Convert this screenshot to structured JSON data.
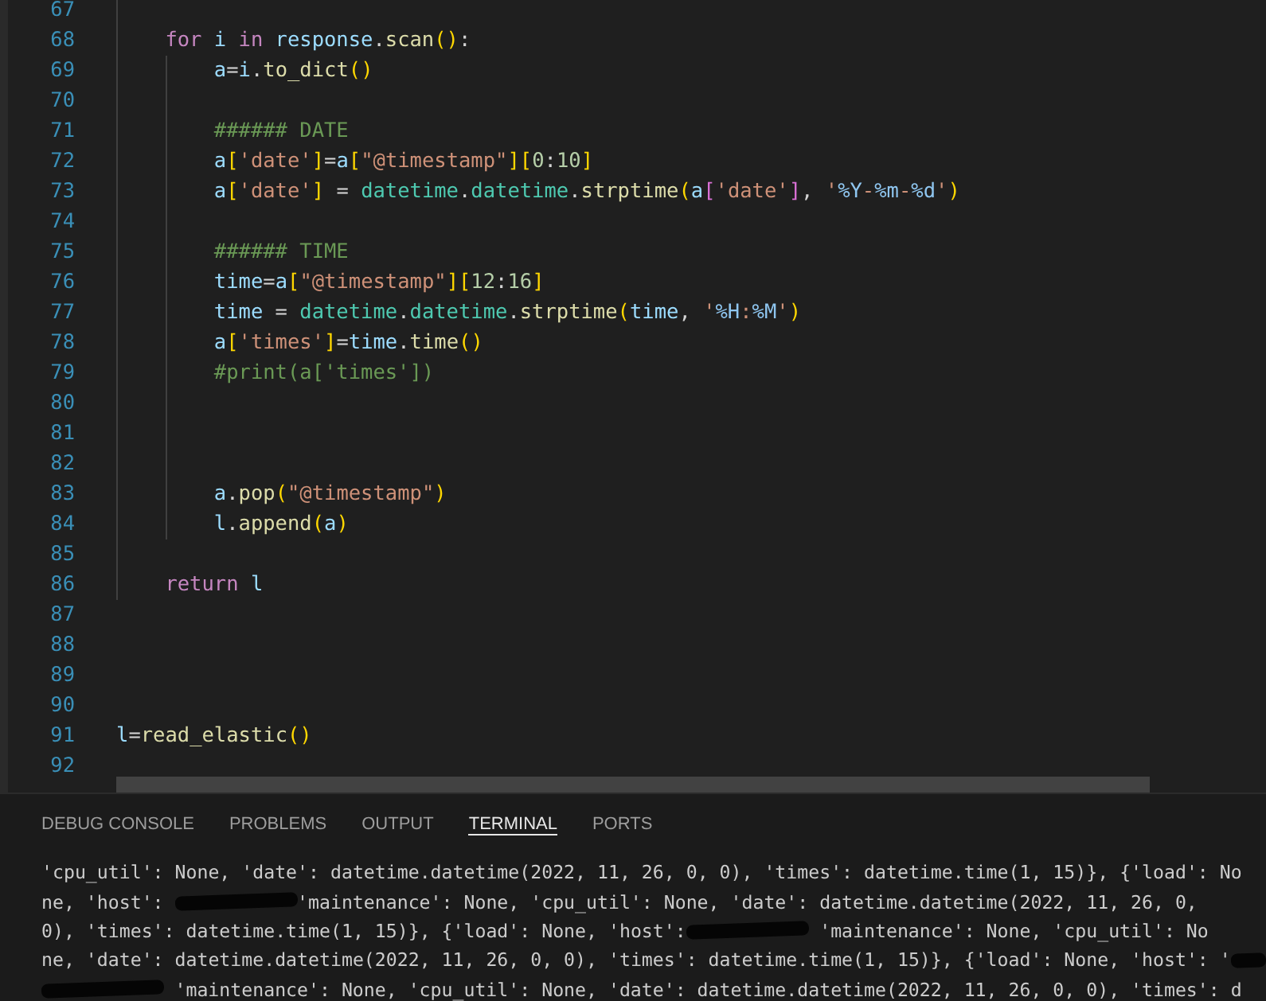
{
  "editor": {
    "lines": [
      {
        "number": "67"
      },
      {
        "number": "68",
        "tokens": [
          {
            "text": "    for",
            "kind": "keyword"
          },
          {
            "text": " i",
            "kind": "variable"
          },
          {
            "text": " in",
            "kind": "keyword"
          },
          {
            "text": " response",
            "kind": "variable"
          },
          {
            "text": ".",
            "kind": "plain"
          },
          {
            "text": "scan",
            "kind": "function"
          },
          {
            "text": "()",
            "kind": "bracket"
          },
          {
            "text": ":",
            "kind": "plain"
          }
        ]
      },
      {
        "number": "69",
        "tokens": [
          {
            "text": "        a",
            "kind": "variable"
          },
          {
            "text": "=",
            "kind": "plain"
          },
          {
            "text": "i",
            "kind": "variable"
          },
          {
            "text": ".",
            "kind": "plain"
          },
          {
            "text": "to_dict",
            "kind": "function"
          },
          {
            "text": "()",
            "kind": "bracket"
          }
        ]
      },
      {
        "number": "70"
      },
      {
        "number": "71",
        "tokens": [
          {
            "text": "        ###### DATE",
            "kind": "comment"
          }
        ]
      },
      {
        "number": "72",
        "tokens": [
          {
            "text": "        a",
            "kind": "variable"
          },
          {
            "text": "[",
            "kind": "bracket"
          },
          {
            "text": "'date'",
            "kind": "string"
          },
          {
            "text": "]",
            "kind": "bracket"
          },
          {
            "text": "=",
            "kind": "plain"
          },
          {
            "text": "a",
            "kind": "variable"
          },
          {
            "text": "[",
            "kind": "bracket"
          },
          {
            "text": "\"@timestamp\"",
            "kind": "string"
          },
          {
            "text": "][",
            "kind": "bracket"
          },
          {
            "text": "0",
            "kind": "number"
          },
          {
            "text": ":",
            "kind": "plain"
          },
          {
            "text": "10",
            "kind": "number"
          },
          {
            "text": "]",
            "kind": "bracket"
          }
        ]
      },
      {
        "number": "73",
        "tokens": [
          {
            "text": "        a",
            "kind": "variable"
          },
          {
            "text": "[",
            "kind": "bracket"
          },
          {
            "text": "'date'",
            "kind": "string"
          },
          {
            "text": "]",
            "kind": "bracket"
          },
          {
            "text": " = ",
            "kind": "plain"
          },
          {
            "text": "datetime",
            "kind": "module"
          },
          {
            "text": ".",
            "kind": "plain"
          },
          {
            "text": "datetime",
            "kind": "module"
          },
          {
            "text": ".",
            "kind": "plain"
          },
          {
            "text": "strptime",
            "kind": "function"
          },
          {
            "text": "(",
            "kind": "bracket"
          },
          {
            "text": "a",
            "kind": "variable"
          },
          {
            "text": "[",
            "kind": "bracket2"
          },
          {
            "text": "'date'",
            "kind": "string"
          },
          {
            "text": "]",
            "kind": "bracket2"
          },
          {
            "text": ", ",
            "kind": "plain"
          },
          {
            "text": "'",
            "kind": "string"
          },
          {
            "text": "%Y",
            "kind": "format"
          },
          {
            "text": "-",
            "kind": "string"
          },
          {
            "text": "%m",
            "kind": "format"
          },
          {
            "text": "-",
            "kind": "string"
          },
          {
            "text": "%d",
            "kind": "format"
          },
          {
            "text": "'",
            "kind": "string"
          },
          {
            "text": ")",
            "kind": "bracket"
          }
        ]
      },
      {
        "number": "74"
      },
      {
        "number": "75",
        "tokens": [
          {
            "text": "        ###### TIME",
            "kind": "comment"
          }
        ]
      },
      {
        "number": "76",
        "tokens": [
          {
            "text": "        time",
            "kind": "variable"
          },
          {
            "text": "=",
            "kind": "plain"
          },
          {
            "text": "a",
            "kind": "variable"
          },
          {
            "text": "[",
            "kind": "bracket"
          },
          {
            "text": "\"@timestamp\"",
            "kind": "string"
          },
          {
            "text": "][",
            "kind": "bracket"
          },
          {
            "text": "12",
            "kind": "number"
          },
          {
            "text": ":",
            "kind": "plain"
          },
          {
            "text": "16",
            "kind": "number"
          },
          {
            "text": "]",
            "kind": "bracket"
          }
        ]
      },
      {
        "number": "77",
        "tokens": [
          {
            "text": "        time",
            "kind": "variable"
          },
          {
            "text": " = ",
            "kind": "plain"
          },
          {
            "text": "datetime",
            "kind": "module"
          },
          {
            "text": ".",
            "kind": "plain"
          },
          {
            "text": "datetime",
            "kind": "module"
          },
          {
            "text": ".",
            "kind": "plain"
          },
          {
            "text": "strptime",
            "kind": "function"
          },
          {
            "text": "(",
            "kind": "bracket"
          },
          {
            "text": "time",
            "kind": "variable"
          },
          {
            "text": ", ",
            "kind": "plain"
          },
          {
            "text": "'",
            "kind": "string"
          },
          {
            "text": "%H",
            "kind": "format"
          },
          {
            "text": ":",
            "kind": "string"
          },
          {
            "text": "%M",
            "kind": "format"
          },
          {
            "text": "'",
            "kind": "string"
          },
          {
            "text": ")",
            "kind": "bracket"
          }
        ]
      },
      {
        "number": "78",
        "tokens": [
          {
            "text": "        a",
            "kind": "variable"
          },
          {
            "text": "[",
            "kind": "bracket"
          },
          {
            "text": "'times'",
            "kind": "string"
          },
          {
            "text": "]",
            "kind": "bracket"
          },
          {
            "text": "=",
            "kind": "plain"
          },
          {
            "text": "time",
            "kind": "variable"
          },
          {
            "text": ".",
            "kind": "plain"
          },
          {
            "text": "time",
            "kind": "function"
          },
          {
            "text": "()",
            "kind": "bracket"
          }
        ]
      },
      {
        "number": "79",
        "tokens": [
          {
            "text": "        #print(a['times'])",
            "kind": "comment"
          }
        ]
      },
      {
        "number": "80"
      },
      {
        "number": "81"
      },
      {
        "number": "82"
      },
      {
        "number": "83",
        "tokens": [
          {
            "text": "        a",
            "kind": "variable"
          },
          {
            "text": ".",
            "kind": "plain"
          },
          {
            "text": "pop",
            "kind": "function"
          },
          {
            "text": "(",
            "kind": "bracket"
          },
          {
            "text": "\"@timestamp\"",
            "kind": "string"
          },
          {
            "text": ")",
            "kind": "bracket"
          }
        ]
      },
      {
        "number": "84",
        "tokens": [
          {
            "text": "        l",
            "kind": "variable"
          },
          {
            "text": ".",
            "kind": "plain"
          },
          {
            "text": "append",
            "kind": "function"
          },
          {
            "text": "(",
            "kind": "bracket"
          },
          {
            "text": "a",
            "kind": "variable"
          },
          {
            "text": ")",
            "kind": "bracket"
          }
        ]
      },
      {
        "number": "85"
      },
      {
        "number": "86",
        "tokens": [
          {
            "text": "    return",
            "kind": "keyword"
          },
          {
            "text": " l",
            "kind": "variable"
          }
        ]
      },
      {
        "number": "87"
      },
      {
        "number": "88"
      },
      {
        "number": "89"
      },
      {
        "number": "90"
      },
      {
        "number": "91",
        "tokens": [
          {
            "text": "l",
            "kind": "variable"
          },
          {
            "text": "=",
            "kind": "plain"
          },
          {
            "text": "read_elastic",
            "kind": "function"
          },
          {
            "text": "()",
            "kind": "bracket"
          }
        ]
      },
      {
        "number": "92"
      }
    ]
  },
  "panel": {
    "tabs": [
      {
        "label": "DEBUG CONSOLE",
        "selected": false
      },
      {
        "label": "PROBLEMS",
        "selected": false
      },
      {
        "label": "OUTPUT",
        "selected": false
      },
      {
        "label": "TERMINAL",
        "selected": true
      },
      {
        "label": "PORTS",
        "selected": false
      }
    ],
    "terminal_lines": [
      [
        {
          "kind": "text",
          "text": "'cpu_util': None, 'date': datetime.datetime(2022, 11, 26, 0, 0), 'times': datetime.time(1, 15)}, {'load': No"
        }
      ],
      [
        {
          "kind": "text",
          "text": "ne, 'host': "
        },
        {
          "kind": "redacted"
        },
        {
          "kind": "text",
          "text": "'maintenance': None, 'cpu_util': None, 'date': datetime.datetime(2022, 11, 26, 0,"
        }
      ],
      [
        {
          "kind": "text",
          "text": "0), 'times': datetime.time(1, 15)}, {'load': None, 'host':"
        },
        {
          "kind": "redacted"
        },
        {
          "kind": "text",
          "text": " 'maintenance': None, 'cpu_util': No"
        }
      ],
      [
        {
          "kind": "text",
          "text": "ne, 'date': datetime.datetime(2022, 11, 26, 0, 0), 'times': datetime.time(1, 15)}, {'load': None, 'host': '"
        },
        {
          "kind": "redacted"
        }
      ],
      [
        {
          "kind": "redacted"
        },
        {
          "kind": "text",
          "text": " 'maintenance': None, 'cpu_util': None, 'date': datetime.datetime(2022, 11, 26, 0, 0), 'times': d"
        }
      ]
    ]
  }
}
